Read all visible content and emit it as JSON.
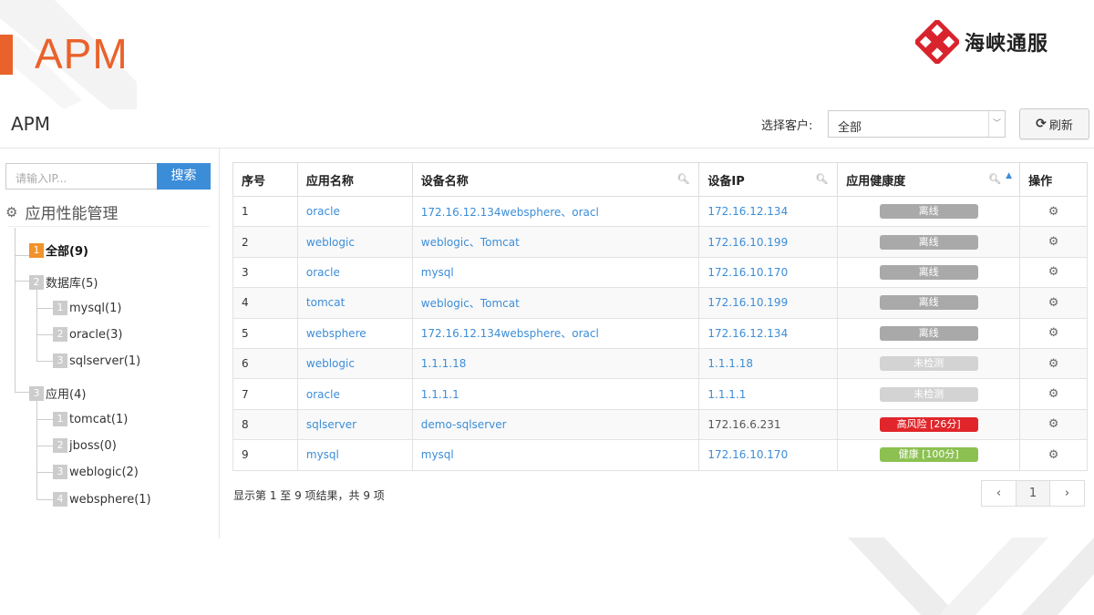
{
  "slide": {
    "title": "APM",
    "logo_text": "海峡通服"
  },
  "page": {
    "heading": "APM",
    "customer_label": "选择客户:",
    "customer_value": "全部",
    "refresh_label": "刷新"
  },
  "sidebar": {
    "ip_placeholder": "请输入IP...",
    "search_label": "搜索",
    "root_label": "应用性能管理",
    "nodes": [
      {
        "num": "1",
        "label": "全部(9)",
        "active": true
      },
      {
        "num": "2",
        "label": "数据库(5)"
      },
      {
        "num": "1",
        "label": "mysql(1)"
      },
      {
        "num": "2",
        "label": "oracle(3)"
      },
      {
        "num": "3",
        "label": "sqlserver(1)"
      },
      {
        "num": "3",
        "label": "应用(4)"
      },
      {
        "num": "1",
        "label": "tomcat(1)"
      },
      {
        "num": "2",
        "label": "jboss(0)"
      },
      {
        "num": "3",
        "label": "weblogic(2)"
      },
      {
        "num": "4",
        "label": "websphere(1)"
      }
    ]
  },
  "table": {
    "columns": [
      "序号",
      "应用名称",
      "设备名称",
      "设备IP",
      "应用健康度",
      "操作"
    ],
    "rows": [
      {
        "no": "1",
        "app": "oracle",
        "device": "172.16.12.134websphere、oracl",
        "ip": "172.16.12.134",
        "health": "离线",
        "health_color": "#a9a9a9"
      },
      {
        "no": "2",
        "app": "weblogic",
        "device": "weblogic、Tomcat",
        "ip": "172.16.10.199",
        "health": "离线",
        "health_color": "#a9a9a9"
      },
      {
        "no": "3",
        "app": "oracle",
        "device": "mysql",
        "ip": "172.16.10.170",
        "health": "离线",
        "health_color": "#a9a9a9"
      },
      {
        "no": "4",
        "app": "tomcat",
        "device": "weblogic、Tomcat",
        "ip": "172.16.10.199",
        "health": "离线",
        "health_color": "#a9a9a9"
      },
      {
        "no": "5",
        "app": "websphere",
        "device": "172.16.12.134websphere、oracl",
        "ip": "172.16.12.134",
        "health": "离线",
        "health_color": "#a9a9a9"
      },
      {
        "no": "6",
        "app": "weblogic",
        "device": "1.1.1.18",
        "ip": "1.1.1.18",
        "health": "未检测",
        "health_color": "#d3d3d3"
      },
      {
        "no": "7",
        "app": "oracle",
        "device": "1.1.1.1",
        "ip": "1.1.1.1",
        "health": "未检测",
        "health_color": "#d3d3d3"
      },
      {
        "no": "8",
        "app": "sqlserver",
        "device": "demo-sqlserver",
        "ip": "172.16.6.231",
        "health": "高风险 [26分]",
        "health_color": "#e0262b"
      },
      {
        "no": "9",
        "app": "mysql",
        "device": "mysql",
        "ip": "172.16.10.170",
        "health": "健康 [100分]",
        "health_color": "#8cc152"
      }
    ]
  },
  "footer": {
    "summary": "显示第 1 至 9 项结果，共 9 项",
    "prev": "‹",
    "page": "1",
    "next": "›"
  }
}
